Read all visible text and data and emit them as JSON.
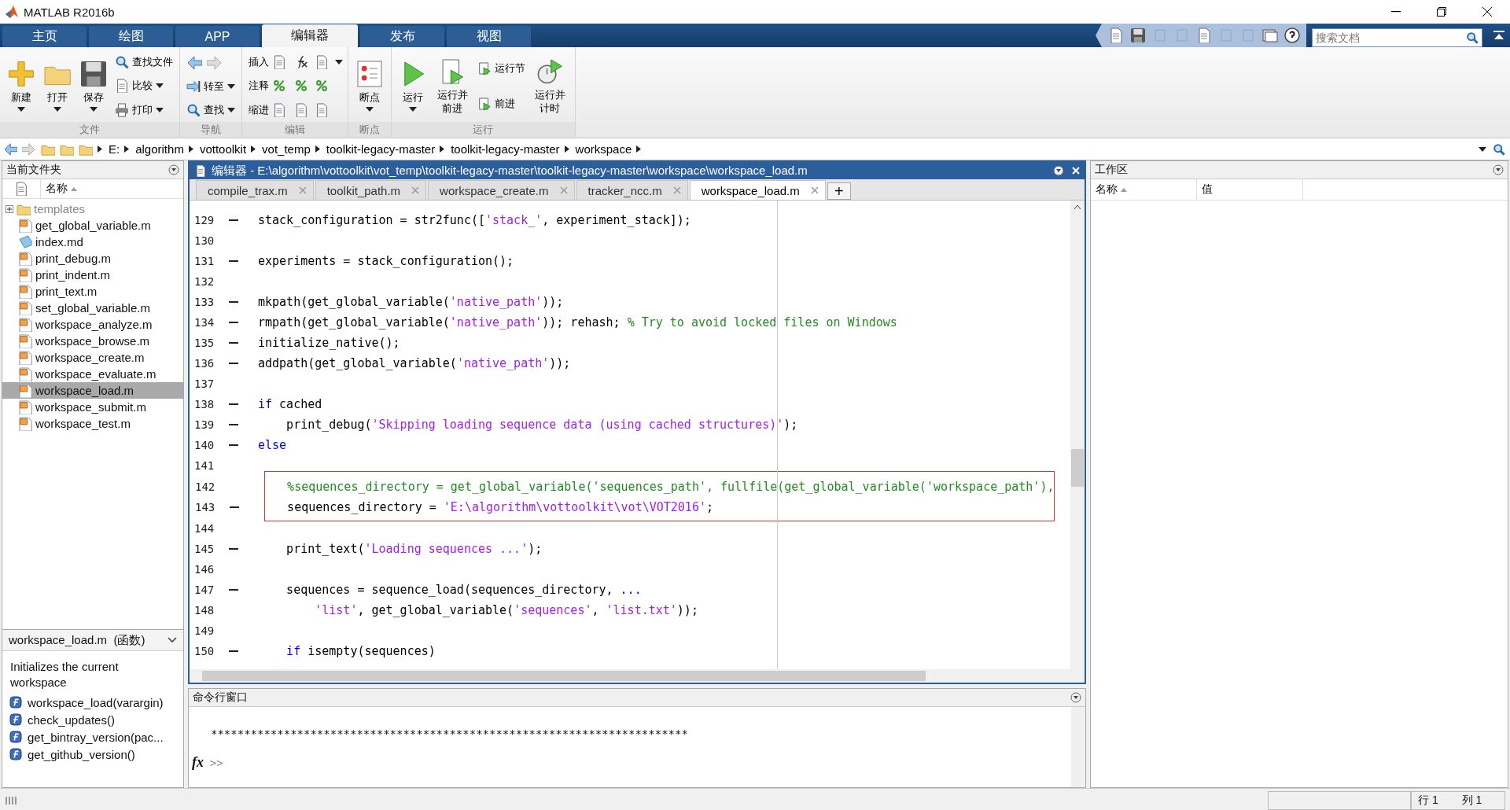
{
  "window": {
    "title": "MATLAB R2016b"
  },
  "ribbon": {
    "tabs": [
      {
        "label": "主页",
        "selected": false
      },
      {
        "label": "绘图",
        "selected": false
      },
      {
        "label": "APP",
        "selected": false
      },
      {
        "label": "编辑器",
        "selected": true
      },
      {
        "label": "发布",
        "selected": false
      },
      {
        "label": "视图",
        "selected": false
      }
    ],
    "search": {
      "placeholder": "搜索文档"
    },
    "groups": [
      {
        "kind": "file",
        "label": "文件",
        "columns": [
          [
            {
              "kind": "large",
              "label": "新建",
              "dropdown": true
            }
          ],
          [
            {
              "kind": "large",
              "label": "打开",
              "dropdown": true
            }
          ],
          [
            {
              "kind": "large",
              "label": "保存",
              "dropdown": true
            }
          ],
          [
            {
              "kind": "small",
              "label": "查找文件",
              "dropdown": false
            },
            {
              "kind": "small",
              "label": "比较",
              "dropdown": true
            },
            {
              "kind": "small",
              "label": "打印",
              "dropdown": true
            }
          ]
        ]
      },
      {
        "kind": "nav",
        "label": "导航",
        "columns": [
          [
            {
              "kind": "arrows"
            },
            {
              "kind": "small",
              "label": "转至",
              "dropdown": true
            },
            {
              "kind": "small",
              "label": "查找",
              "dropdown": true
            }
          ]
        ]
      },
      {
        "kind": "edit",
        "label": "编辑",
        "columns": [
          [
            {
              "kind": "row",
              "label": "插入",
              "dropdown": true
            },
            {
              "kind": "row",
              "label": "注释",
              "dropdown": false
            },
            {
              "kind": "row",
              "label": "缩进",
              "dropdown": false
            }
          ]
        ]
      },
      {
        "kind": "breakpoints",
        "label": "断点",
        "columns": [
          [
            {
              "kind": "large",
              "label": "断点",
              "dropdown": true
            }
          ]
        ]
      },
      {
        "kind": "run",
        "label": "运行",
        "columns": [
          [
            {
              "kind": "large",
              "label": "运行",
              "dropdown": true
            }
          ],
          [
            {
              "kind": "large",
              "label": "运行并前进",
              "dropdown": false
            }
          ],
          [
            {
              "kind": "small",
              "label": "运行节",
              "dropdown": false
            },
            {
              "kind": "small",
              "label": "前进",
              "dropdown": false
            }
          ],
          [
            {
              "kind": "large",
              "label": "运行并计时",
              "dropdown": false
            }
          ]
        ]
      }
    ]
  },
  "address_bar": {
    "path": [
      "E:",
      "algorithm",
      "vottoolkit",
      "vot_temp",
      "toolkit-legacy-master",
      "toolkit-legacy-master",
      "workspace"
    ]
  },
  "current_folder": {
    "title": "当前文件夹",
    "column": "名称",
    "files": [
      {
        "name": "templates",
        "kind": "folder",
        "dimmed": true,
        "selected": false
      },
      {
        "name": "get_global_variable.m",
        "kind": "m",
        "dimmed": false,
        "selected": false
      },
      {
        "name": "index.md",
        "kind": "md",
        "dimmed": false,
        "selected": false
      },
      {
        "name": "print_debug.m",
        "kind": "m",
        "dimmed": false,
        "selected": false
      },
      {
        "name": "print_indent.m",
        "kind": "m",
        "dimmed": false,
        "selected": false
      },
      {
        "name": "print_text.m",
        "kind": "m",
        "dimmed": false,
        "selected": false
      },
      {
        "name": "set_global_variable.m",
        "kind": "m",
        "dimmed": false,
        "selected": false
      },
      {
        "name": "workspace_analyze.m",
        "kind": "m",
        "dimmed": false,
        "selected": false
      },
      {
        "name": "workspace_browse.m",
        "kind": "m",
        "dimmed": false,
        "selected": false
      },
      {
        "name": "workspace_create.m",
        "kind": "m",
        "dimmed": false,
        "selected": false
      },
      {
        "name": "workspace_evaluate.m",
        "kind": "m",
        "dimmed": false,
        "selected": false
      },
      {
        "name": "workspace_load.m",
        "kind": "m",
        "dimmed": false,
        "selected": true
      },
      {
        "name": "workspace_submit.m",
        "kind": "m",
        "dimmed": false,
        "selected": false
      },
      {
        "name": "workspace_test.m",
        "kind": "m",
        "dimmed": false,
        "selected": false
      }
    ],
    "details": {
      "title": "workspace_load.m  (函数)",
      "description": "Initializes the current workspace",
      "functions": [
        "workspace_load(varargin)",
        "check_updates()",
        "get_bintray_version(pac...",
        "get_github_version()"
      ]
    }
  },
  "editor": {
    "title": "编辑器 - E:\\algorithm\\vottoolkit\\vot_temp\\toolkit-legacy-master\\toolkit-legacy-master\\workspace\\workspace_load.m",
    "tabs": [
      {
        "label": "compile_trax.m",
        "selected": false
      },
      {
        "label": "toolkit_path.m",
        "selected": false
      },
      {
        "label": "workspace_create.m",
        "selected": false
      },
      {
        "label": "tracker_ncc.m",
        "selected": false
      },
      {
        "label": "workspace_load.m",
        "selected": true
      }
    ],
    "new_tab": "+",
    "lines": [
      {
        "number": "129",
        "executable": true,
        "boxed": false,
        "tokens": [
          {
            "kind": "plain",
            "text": "stack_configuration = str2func(["
          },
          {
            "kind": "string",
            "text": "'stack_'"
          },
          {
            "kind": "plain",
            "text": ", experiment_stack]);"
          }
        ]
      },
      {
        "number": "130",
        "executable": false,
        "boxed": false
      },
      {
        "number": "131",
        "executable": true,
        "boxed": false,
        "tokens": [
          {
            "kind": "plain",
            "text": "experiments = stack_configuration();"
          }
        ]
      },
      {
        "number": "132",
        "executable": false,
        "boxed": false
      },
      {
        "number": "133",
        "executable": true,
        "boxed": false,
        "tokens": [
          {
            "kind": "plain",
            "text": "mkpath(get_global_variable("
          },
          {
            "kind": "string",
            "text": "'native_path'"
          },
          {
            "kind": "plain",
            "text": "));"
          }
        ]
      },
      {
        "number": "134",
        "executable": true,
        "boxed": false,
        "tokens": [
          {
            "kind": "plain",
            "text": "rmpath(get_global_variable("
          },
          {
            "kind": "string",
            "text": "'native_path'"
          },
          {
            "kind": "plain",
            "text": ")); rehash; "
          },
          {
            "kind": "comment",
            "text": "% Try to avoid locked files on Windows"
          }
        ]
      },
      {
        "number": "135",
        "executable": true,
        "boxed": false,
        "tokens": [
          {
            "kind": "plain",
            "text": "initialize_native();"
          }
        ]
      },
      {
        "number": "136",
        "executable": true,
        "boxed": false,
        "tokens": [
          {
            "kind": "plain",
            "text": "addpath(get_global_variable("
          },
          {
            "kind": "string",
            "text": "'native_path'"
          },
          {
            "kind": "plain",
            "text": "));"
          }
        ]
      },
      {
        "number": "137",
        "executable": false,
        "boxed": false
      },
      {
        "number": "138",
        "executable": true,
        "boxed": false,
        "tokens": [
          {
            "kind": "keyword",
            "text": "if"
          },
          {
            "kind": "plain",
            "text": " cached"
          }
        ]
      },
      {
        "number": "139",
        "executable": true,
        "boxed": false,
        "tokens": [
          {
            "kind": "plain",
            "text": "    print_debug("
          },
          {
            "kind": "string",
            "text": "'Skipping loading sequence data (using cached structures)'"
          },
          {
            "kind": "plain",
            "text": ");"
          }
        ]
      },
      {
        "number": "140",
        "executable": true,
        "boxed": false,
        "tokens": [
          {
            "kind": "keyword",
            "text": "else"
          }
        ]
      },
      {
        "number": "141",
        "executable": false,
        "boxed": false
      },
      {
        "number": "142",
        "executable": false,
        "boxed": true,
        "tokens": [
          {
            "kind": "comment",
            "text": "    %sequences_directory = get_global_variable('sequences_path', fullfile(get_global_variable('workspace_path'),"
          }
        ]
      },
      {
        "number": "143",
        "executable": true,
        "boxed": true,
        "tokens": [
          {
            "kind": "plain",
            "text": "    sequences_directory = "
          },
          {
            "kind": "string",
            "text": "'E:\\algorithm\\vottoolkit\\vot\\VOT2016'"
          },
          {
            "kind": "plain",
            "text": ";"
          }
        ]
      },
      {
        "number": "144",
        "executable": false,
        "boxed": false
      },
      {
        "number": "145",
        "executable": true,
        "boxed": false,
        "tokens": [
          {
            "kind": "plain",
            "text": "    print_text("
          },
          {
            "kind": "string",
            "text": "'Loading sequences ...'"
          },
          {
            "kind": "plain",
            "text": ");"
          }
        ]
      },
      {
        "number": "146",
        "executable": false,
        "boxed": false
      },
      {
        "number": "147",
        "executable": true,
        "boxed": false,
        "tokens": [
          {
            "kind": "plain",
            "text": "    sequences = sequence_load(sequences_directory, "
          },
          {
            "kind": "keyword",
            "text": "..."
          }
        ]
      },
      {
        "number": "148",
        "executable": false,
        "boxed": false,
        "tokens": [
          {
            "kind": "string",
            "text": "        'list'"
          },
          {
            "kind": "plain",
            "text": ", get_global_variable("
          },
          {
            "kind": "string",
            "text": "'sequences'"
          },
          {
            "kind": "plain",
            "text": ", "
          },
          {
            "kind": "string",
            "text": "'list.txt'"
          },
          {
            "kind": "plain",
            "text": "));"
          }
        ]
      },
      {
        "number": "149",
        "executable": false,
        "boxed": false
      },
      {
        "number": "150",
        "executable": true,
        "boxed": false,
        "tokens": [
          {
            "kind": "keyword",
            "text": "    if"
          },
          {
            "kind": "plain",
            "text": " isempty(sequences)"
          }
        ]
      }
    ]
  },
  "command_window": {
    "title": "命令行窗口",
    "output": "************************************************************************",
    "function_browser": "fx",
    "prompt": ">>"
  },
  "workspace": {
    "title": "工作区",
    "columns": [
      "名称",
      "值"
    ]
  },
  "status_bar": {
    "row": "行 1",
    "column": "列 1"
  }
}
